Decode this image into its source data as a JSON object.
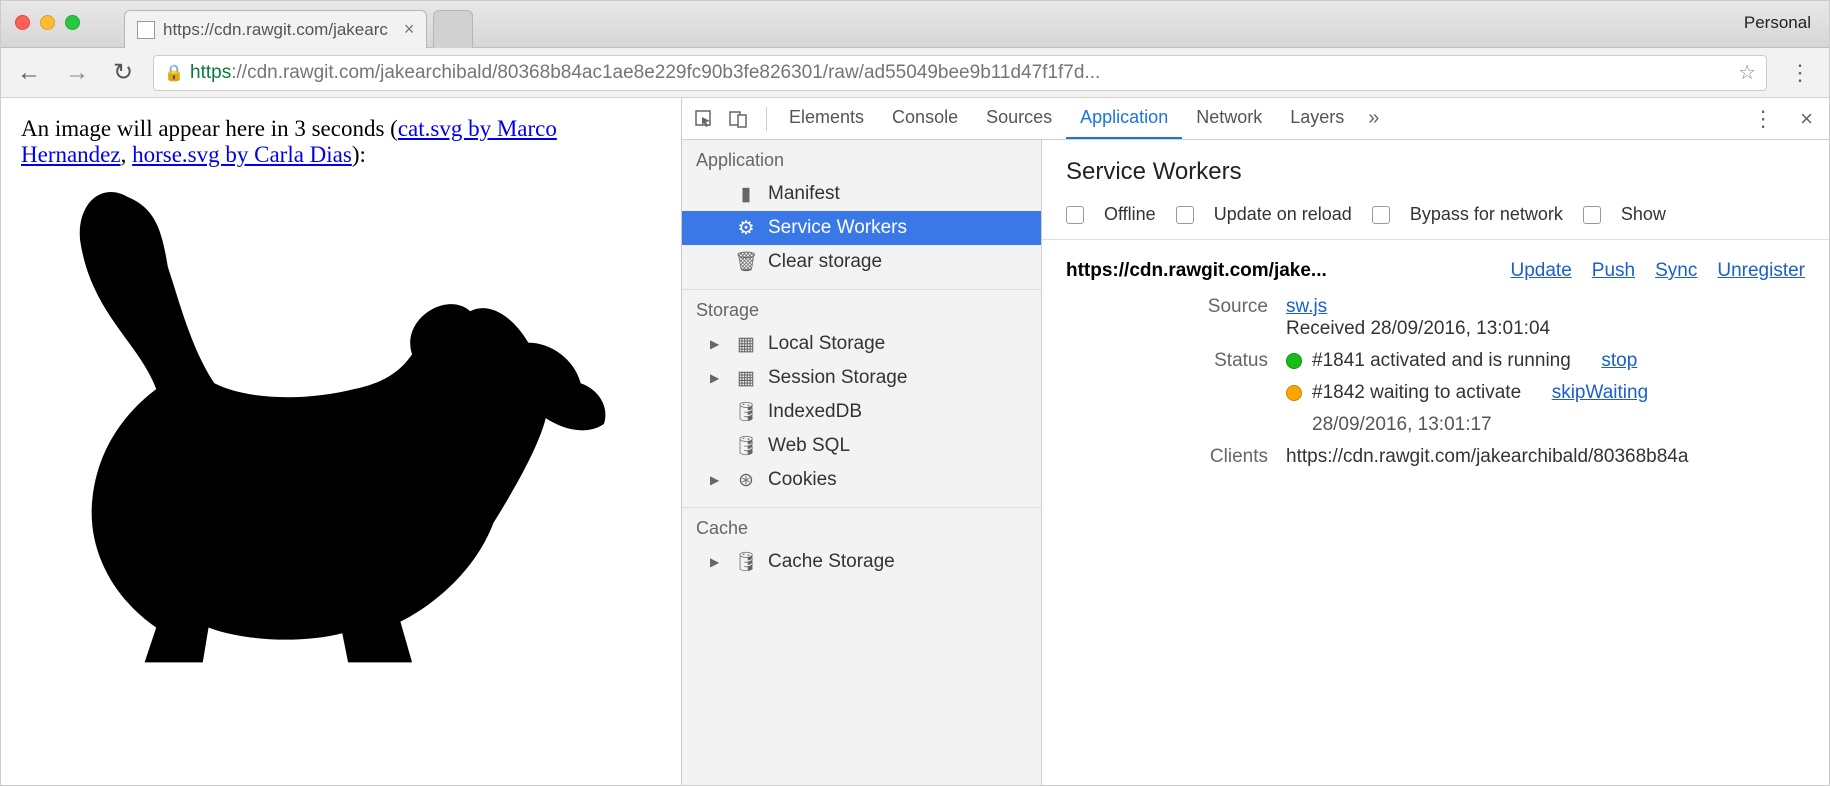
{
  "window": {
    "profile": "Personal"
  },
  "tabs": [
    {
      "label": "https://cdn.rawgit.com/jakearc"
    }
  ],
  "omnibox": {
    "scheme": "https",
    "rest": "://cdn.rawgit.com/jakearchibald/80368b84ac1ae8e229fc90b3fe826301/raw/ad55049bee9b11d47f1f7d..."
  },
  "page": {
    "prefix": "An image will appear here in 3 seconds (",
    "link1": "cat.svg by Marco Hernandez",
    "comma": ", ",
    "link2": "horse.svg by Carla Dias",
    "suffix": "):"
  },
  "devtools": {
    "tabs": [
      "Elements",
      "Console",
      "Sources",
      "Application",
      "Network",
      "Layers"
    ],
    "active_tab": "Application",
    "sidebar": {
      "application_header": "Application",
      "app_items": [
        "Manifest",
        "Service Workers",
        "Clear storage"
      ],
      "storage_header": "Storage",
      "storage_items": [
        "Local Storage",
        "Session Storage",
        "IndexedDB",
        "Web SQL",
        "Cookies"
      ],
      "cache_header": "Cache",
      "cache_items": [
        "Cache Storage"
      ]
    },
    "panel": {
      "title": "Service Workers",
      "checks": [
        "Offline",
        "Update on reload",
        "Bypass for network",
        "Show"
      ],
      "origin": "https://cdn.rawgit.com/jake...",
      "actions": [
        "Update",
        "Push",
        "Sync",
        "Unregister"
      ],
      "source_label": "Source",
      "source_link": "sw.js",
      "source_received": "Received 28/09/2016, 13:01:04",
      "status_label": "Status",
      "status1": "#1841 activated and is running",
      "status1_action": "stop",
      "status2": "#1842 waiting to activate",
      "status2_action": "skipWaiting",
      "status2_time": "28/09/2016, 13:01:17",
      "clients_label": "Clients",
      "clients_value": "https://cdn.rawgit.com/jakearchibald/80368b84a"
    }
  }
}
